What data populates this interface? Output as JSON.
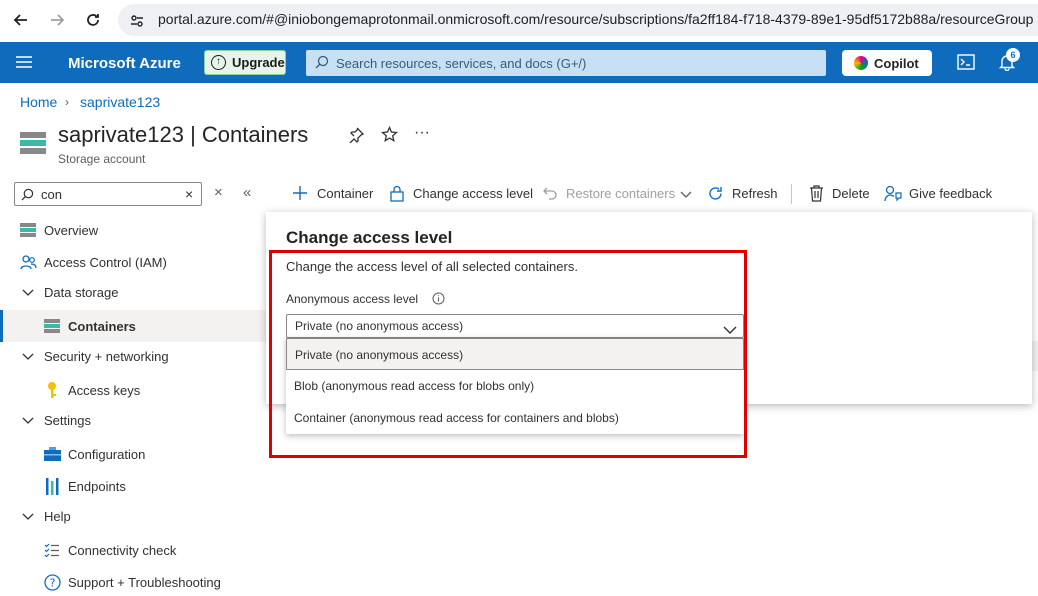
{
  "browser": {
    "url": "portal.azure.com/#@iniobongemaprotonmail.onmicrosoft.com/resource/subscriptions/fa2ff184-f718-4379-89e1-95df5172b88a/resourceGroup"
  },
  "header": {
    "brand": "Microsoft Azure",
    "upgrade_label": "Upgrade",
    "search_placeholder": "Search resources, services, and docs (G+/)",
    "copilot_label": "Copilot",
    "notification_count": "6"
  },
  "breadcrumb": {
    "home": "Home",
    "current": "saprivate123"
  },
  "page": {
    "title": "saprivate123 | Containers",
    "subtitle": "Storage account"
  },
  "sidebar": {
    "filter_value": "con",
    "items": [
      {
        "label": "Overview",
        "icon": "overview-icon"
      },
      {
        "label": "Access Control (IAM)",
        "icon": "people-icon"
      },
      {
        "label": "Data storage",
        "icon": "chevron-down-icon"
      },
      {
        "label": "Containers",
        "icon": "containers-icon"
      },
      {
        "label": "Security + networking",
        "icon": "chevron-down-icon"
      },
      {
        "label": "Access keys",
        "icon": "key-icon"
      },
      {
        "label": "Settings",
        "icon": "chevron-down-icon"
      },
      {
        "label": "Configuration",
        "icon": "briefcase-icon"
      },
      {
        "label": "Endpoints",
        "icon": "endpoints-icon"
      },
      {
        "label": "Help",
        "icon": "chevron-down-icon"
      },
      {
        "label": "Connectivity check",
        "icon": "checklist-icon"
      },
      {
        "label": "Support + Troubleshooting",
        "icon": "question-icon"
      }
    ]
  },
  "toolbar": {
    "container": "Container",
    "change_access": "Change access level",
    "restore": "Restore containers",
    "refresh": "Refresh",
    "delete": "Delete",
    "feedback": "Give feedback"
  },
  "panel": {
    "title": "Change access level",
    "description": "Change the access level of all selected containers.",
    "field_label": "Anonymous access level",
    "selected_value": "Private (no anonymous access)",
    "options": [
      "Private (no anonymous access)",
      "Blob (anonymous read access for blobs only)",
      "Container (anonymous read access for containers and blobs)"
    ]
  },
  "colors": {
    "azure_blue": "#0f6cbd",
    "highlight_red": "#e00000"
  }
}
